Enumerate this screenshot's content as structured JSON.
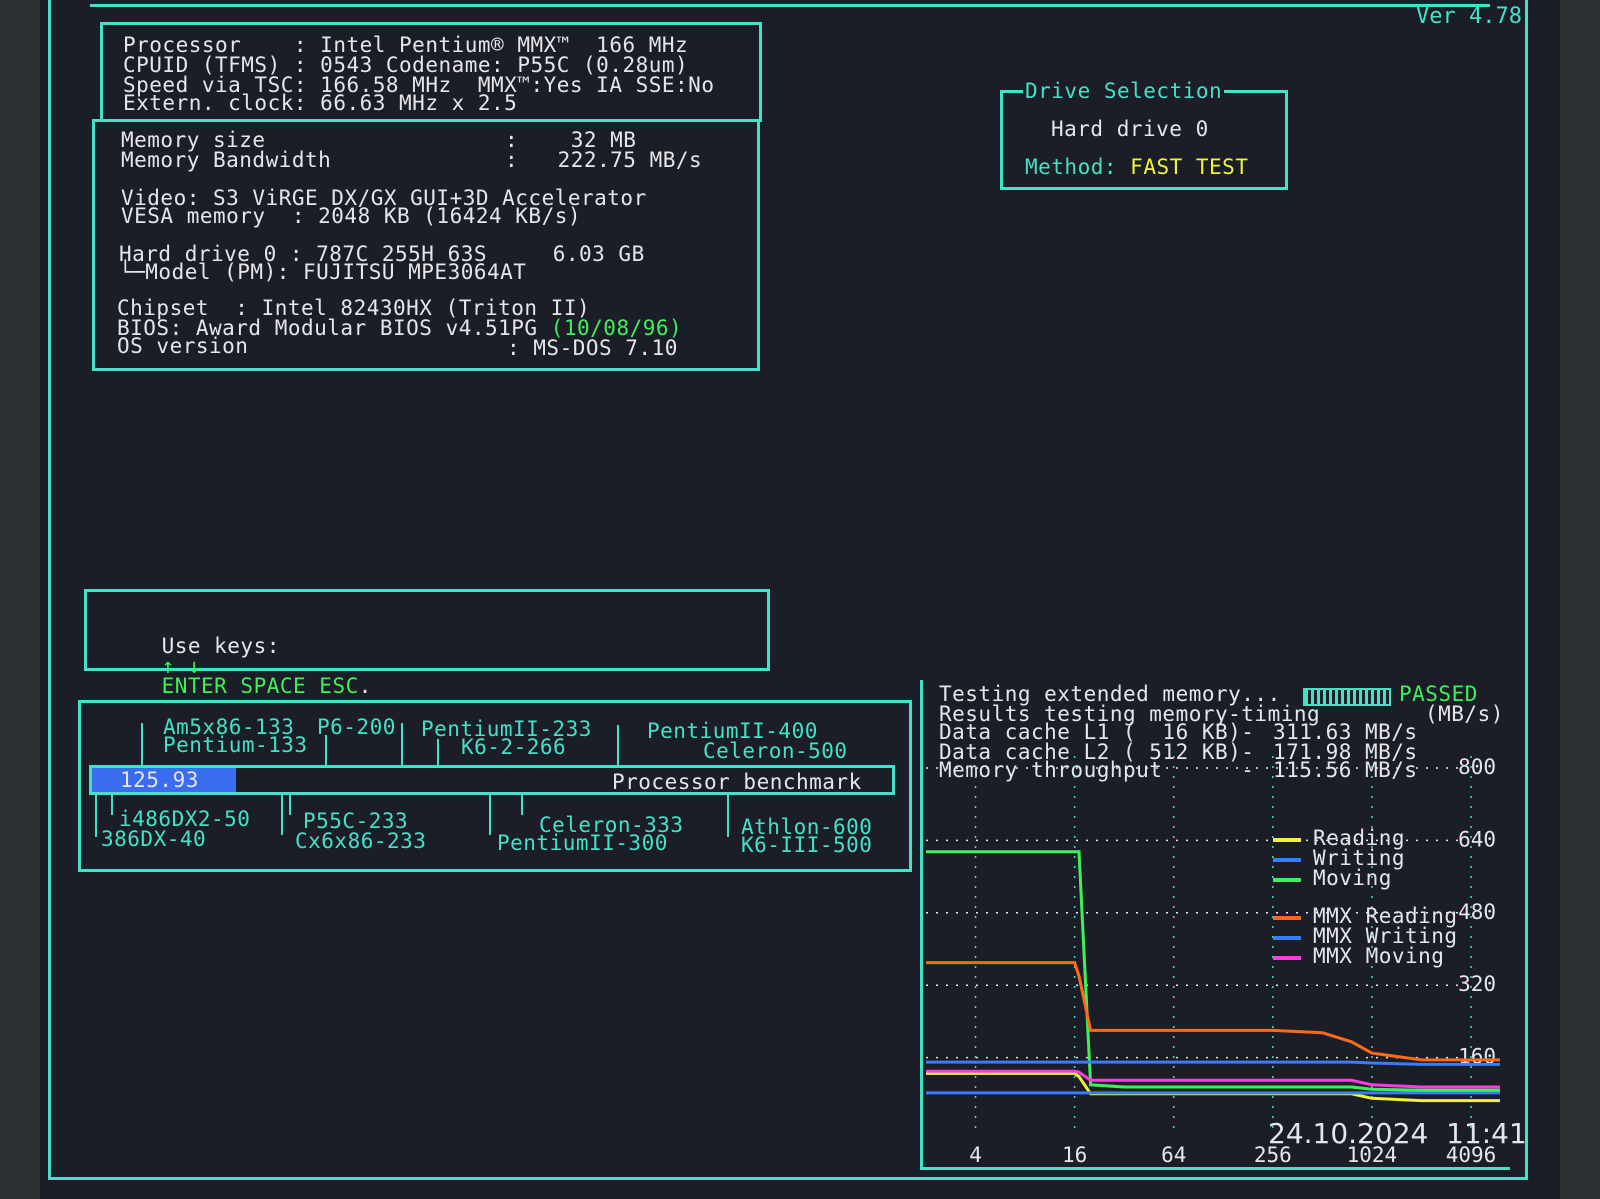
{
  "version": "Ver 4.78",
  "sysinfo": {
    "processor_label": "Processor    :",
    "processor_value": "Intel Pentium® MMX™  166 MHz",
    "cpuid_label": "CPUID (TFMS) :",
    "cpuid_value": "0543 Codename: P55C (0.28um)",
    "speed_label": "Speed via TSC:",
    "speed_value": "166.58 MHz  MMX™:Yes IA SSE:No",
    "extclock_label": "Extern. clock:",
    "extclock_value": "66.63 MHz x 2.5",
    "memsize_label": "Memory size",
    "memsize_value": ":    32 MB",
    "membw_label": "Memory Bandwidth",
    "membw_value": ":   222.75 MB/s",
    "video_line": "Video: S3 ViRGE DX/GX GUI+3D Accelerator",
    "vesa_line": "VESA memory  : 2048 KB (16424 KB/s)",
    "hdd_line": "Hard drive 0 : 787C 255H 63S     6.03 GB",
    "hdd_model_line": "└─Model (PM): FUJITSU MPE3064AT",
    "chipset_line": "Chipset  : Intel 82430HX (Triton II)",
    "bios_line": "BIOS: Award Modular BIOS v4.51PG",
    "bios_date": "(10/08/96)",
    "os_label": "OS version",
    "os_value": ": MS-DOS 7.10"
  },
  "drive_selection": {
    "title": "Drive Selection",
    "drive": "Hard drive 0",
    "method_label": "Method:",
    "method_value": "FAST TEST"
  },
  "keys": {
    "label": "Use keys:",
    "arrows": "↑ ↓",
    "keys": "ENTER SPACE ESC",
    "dot": "."
  },
  "benchmark": {
    "score": "125.93",
    "label": "Processor benchmark",
    "top_refs": [
      "Am5x86-133",
      "P6-200",
      "Pentium-133",
      "PentiumII-233",
      "K6-2-266",
      "PentiumII-400",
      "Celeron-500"
    ],
    "bottom_refs": [
      "i486DX2-50",
      "386DX-40",
      "P55C-233",
      "Cx6x86-233",
      "Celeron-333",
      "PentiumII-300",
      "Athlon-600",
      "K6-III-500"
    ]
  },
  "memtest": {
    "line1_label": "Testing extended memory...",
    "line1_status": "PASSED",
    "line2": "Results testing memory-timing",
    "units": "(MB/s)",
    "l1_label": "Data cache L1 (  16 KB)-",
    "l1_value": "311.63 MB/s",
    "l2_label": "Data cache L2 ( 512 KB)-",
    "l2_value": "171.98 MB/s",
    "mem_label": "Memory throughput      -",
    "mem_value": "115.56 MB/s"
  },
  "chart_data": {
    "type": "line",
    "xlabel": "",
    "ylabel": "",
    "x_ticks": [
      "4",
      "16",
      "64",
      "256",
      "1024",
      "4096"
    ],
    "y_ticks": [
      "160",
      "320",
      "480",
      "640",
      "800"
    ],
    "ylim": [
      0,
      800
    ],
    "x_log2": true,
    "x": [
      2,
      4,
      8,
      16,
      17,
      20,
      32,
      64,
      128,
      256,
      512,
      768,
      1024,
      2048,
      4096,
      6144
    ],
    "series": [
      {
        "name": "Reading",
        "color": "#f2f23a",
        "values": [
          125,
          125,
          125,
          125,
          118,
          80,
          80,
          80,
          80,
          80,
          80,
          80,
          70,
          65,
          65,
          65
        ]
      },
      {
        "name": "Writing",
        "color": "#3a7cff",
        "values": [
          82,
          82,
          82,
          82,
          82,
          82,
          82,
          82,
          82,
          82,
          82,
          82,
          82,
          82,
          82,
          82
        ]
      },
      {
        "name": "Moving",
        "color": "#3ef05a",
        "values": [
          615,
          615,
          615,
          615,
          615,
          100,
          95,
          95,
          95,
          95,
          95,
          95,
          90,
          88,
          88,
          88
        ]
      },
      {
        "name": "MMX Reading",
        "color": "#ff6a1a",
        "values": [
          370,
          370,
          370,
          370,
          340,
          220,
          220,
          220,
          220,
          220,
          215,
          195,
          170,
          155,
          155,
          155
        ]
      },
      {
        "name": "MMX Writing",
        "color": "#3a7cff",
        "values": [
          150,
          150,
          150,
          150,
          150,
          150,
          150,
          150,
          150,
          150,
          150,
          150,
          148,
          145,
          145,
          145
        ]
      },
      {
        "name": "MMX Moving",
        "color": "#ff3ce0",
        "values": [
          130,
          130,
          130,
          130,
          128,
          110,
          110,
          110,
          110,
          110,
          110,
          110,
          100,
          95,
          95,
          95
        ]
      }
    ]
  },
  "timestamp": "24.10.2024  11:41"
}
